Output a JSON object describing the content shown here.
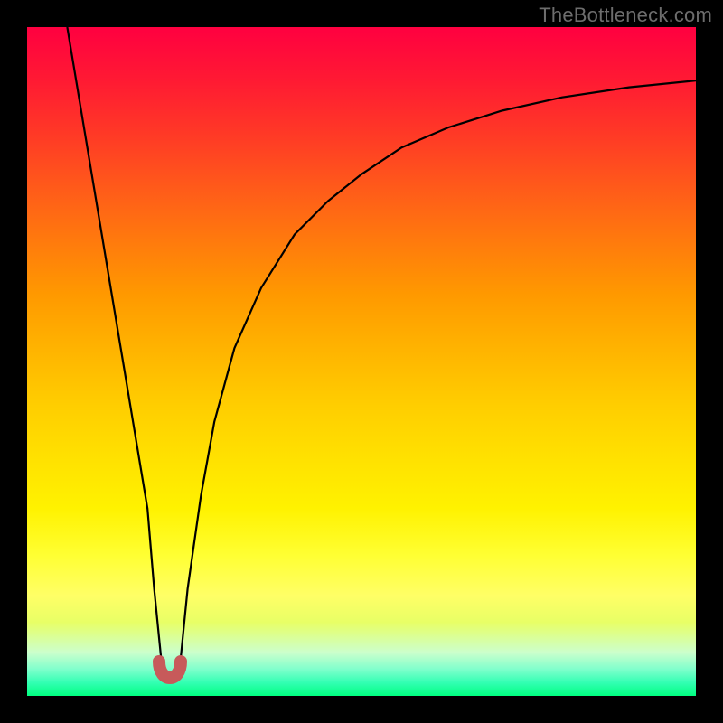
{
  "watermark": {
    "text": "TheBottleneck.com"
  },
  "chart_data": {
    "type": "line",
    "title": "",
    "xlabel": "",
    "ylabel": "",
    "xlim": [
      0,
      100
    ],
    "ylim": [
      0,
      100
    ],
    "grid": false,
    "legend": false,
    "series": [
      {
        "name": "bottleneck-curve",
        "x": [
          6,
          8,
          10,
          12,
          14,
          16,
          18,
          19,
          20,
          21,
          22,
          23,
          24,
          26,
          28,
          31,
          35,
          40,
          45,
          50,
          56,
          63,
          71,
          80,
          90,
          100
        ],
        "y": [
          100,
          88,
          76,
          64,
          52,
          40,
          28,
          16,
          6,
          3,
          3,
          6,
          16,
          30,
          41,
          52,
          61,
          69,
          74,
          78,
          82,
          85,
          87.5,
          89.5,
          91,
          92
        ],
        "color": "#000000",
        "linewidth": 2
      }
    ],
    "markers": [
      {
        "name": "optimal-point",
        "x": 20.5,
        "y": 3,
        "shape": "u",
        "color": "#c75a5a",
        "size": 22
      }
    ],
    "background": {
      "type": "vertical-gradient",
      "stops": [
        {
          "pos": 0,
          "color": "#ff0040"
        },
        {
          "pos": 50,
          "color": "#ffb300"
        },
        {
          "pos": 80,
          "color": "#ffff33"
        },
        {
          "pos": 100,
          "color": "#00ff80"
        }
      ]
    }
  }
}
